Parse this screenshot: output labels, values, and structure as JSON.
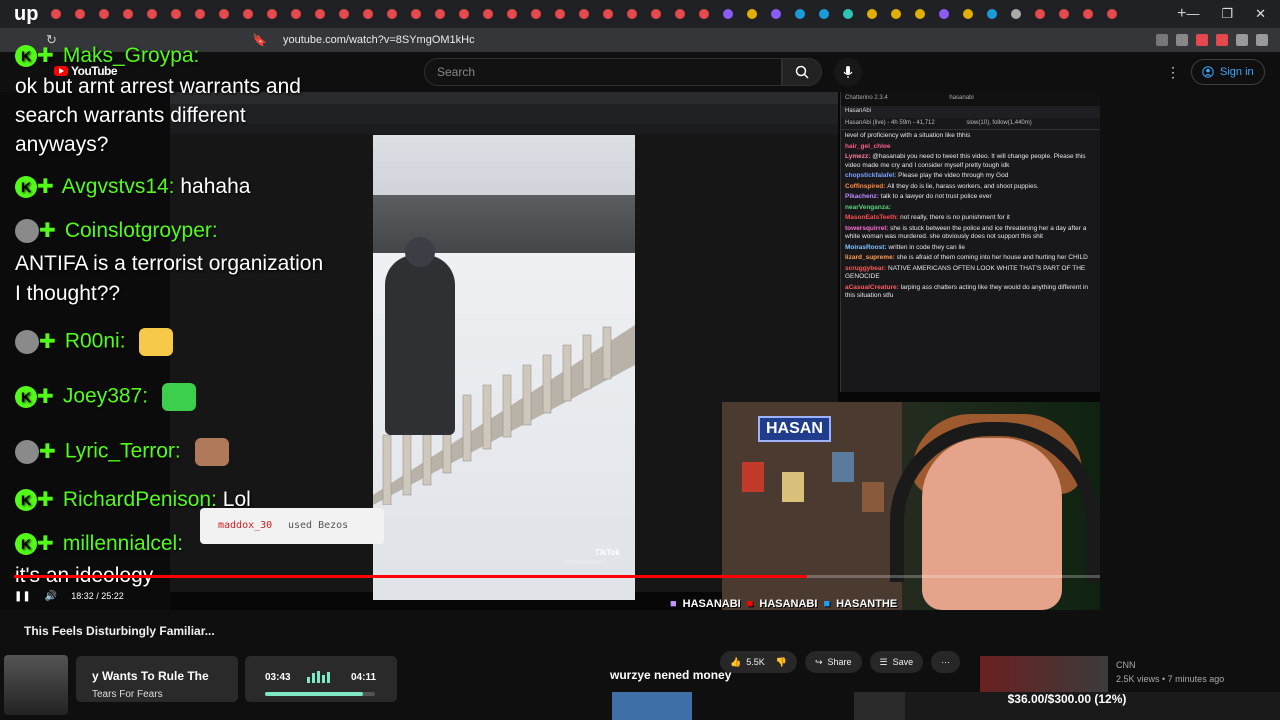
{
  "browser": {
    "brand": "up",
    "url": "youtube.com/watch?v=8SYmgOM1kHc",
    "tab_colors": [
      "#e5484d",
      "#e5484d",
      "#e5484d",
      "#e5484d",
      "#e5484d",
      "#e5484d",
      "#e5484d",
      "#e5484d",
      "#e5484d",
      "#e5484d",
      "#e5484d",
      "#e5484d",
      "#e5484d",
      "#e5484d",
      "#e5484d",
      "#e5484d",
      "#e5484d",
      "#e5484d",
      "#e5484d",
      "#e5484d",
      "#e5484d",
      "#e5484d",
      "#e5484d",
      "#e5484d",
      "#e5484d",
      "#e5484d",
      "#e5484d",
      "#e5484d",
      "#8b5cf6",
      "#e0b000",
      "#8b5cf6",
      "#1a9bd7",
      "#1a9bd7",
      "#2ec4b6",
      "#e0b000",
      "#e0b000",
      "#e0b000",
      "#8b5cf6",
      "#e0b000",
      "#1a9bd7",
      "#aaaaaa",
      "#e5484d",
      "#e5484d",
      "#e5484d",
      "#e5484d"
    ]
  },
  "youtube": {
    "logo": "YouTube",
    "search_placeholder": "Search",
    "sign_in": "Sign in"
  },
  "stream_chat": [
    {
      "user": "Maks_Groypa:",
      "msg": ""
    },
    {
      "user": "",
      "msg": "ok but arnt arrest warrants and"
    },
    {
      "user": "",
      "msg": "search warrants different"
    },
    {
      "user": "",
      "msg": "anyways?"
    },
    {
      "user": "Avgvstvs14:",
      "msg": "hahaha"
    },
    {
      "user": "Coinslotgroyper:",
      "msg": ""
    },
    {
      "user": "",
      "msg": "ANTIFA is a terrorist organization"
    },
    {
      "user": "",
      "msg": "I thought??"
    },
    {
      "user": "R00ni:",
      "msg": ""
    },
    {
      "user": "Joey387:",
      "msg": ""
    },
    {
      "user": "Lyric_Terror:",
      "msg": ""
    },
    {
      "user": "RichardPenison:",
      "msg": "Lol"
    },
    {
      "user": "millennialcel:",
      "msg": ""
    },
    {
      "user": "",
      "msg": "it's an ideology"
    }
  ],
  "redeem": {
    "user": "maddox_30",
    "text": "used Bezos"
  },
  "chatterino": {
    "title": "Chatterino 2.3.4",
    "channel": "hasanabi",
    "tab": "HasanAbi",
    "status": "HasanAbi (live) - 4h 59m - 41,712",
    "mode": "slow(10), follow(1,440m)",
    "messages": [
      {
        "user": "",
        "text": "level of proficiency with a situation like thhis"
      },
      {
        "user": "hair_gel_chloe",
        "text": ""
      },
      {
        "user": "Lymezz:",
        "text": "@hasanabi you need to tweet this video. It will change people. Please this video made me cry and I consider myself pretty tough idk"
      },
      {
        "user": "chopstickfalafel:",
        "text": "Please play the video through my God"
      },
      {
        "user": "Coffinspired:",
        "text": "All they do is lie, harass workers, and shoot puppies."
      },
      {
        "user": "Pikachenz:",
        "text": "talk to a lawyer do not trust police ever"
      },
      {
        "user": "nearVenganza:",
        "text": ""
      },
      {
        "user": "MasonEatsTeeth:",
        "text": "not really, there is no punishment for it"
      },
      {
        "user": "towersquirrel:",
        "text": "she is stuck between the police and ice threatening her a day after a white woman was murdered. she obviously does not support this shit"
      },
      {
        "user": "MoirasRoost:",
        "text": "written in code they can lie"
      },
      {
        "user": "lizard_supreme:",
        "text": "she is afraid of them coming into her house and hurting her CHILD"
      },
      {
        "user": "scruggybear:",
        "text": "NATIVE AMERICANS OFTEN LOOK WHITE THAT'S PART OF THE GENOCIDE"
      },
      {
        "user": "aCasualCreature:",
        "text": "larping ass chatters acting like they would do anything different in this situation stfu"
      }
    ]
  },
  "tiktok": {
    "watermark": "TikTok",
    "user": "@stormbaby27"
  },
  "webcam": {
    "logo": "HASAN"
  },
  "socials": [
    "HASANABI",
    "HASANABI",
    "HASANTHE"
  ],
  "player": {
    "current": "18:32",
    "duration": "25:22",
    "progress_fraction": 0.73
  },
  "video": {
    "title": "This Feels Disturbingly Familiar...",
    "likes": "5.5K",
    "share": "Share",
    "save": "Save"
  },
  "music": {
    "title": "y Wants To Rule The",
    "artist": "Tears For Fears",
    "current": "03:43",
    "total": "04:11",
    "progress_fraction": 0.89
  },
  "tts": "wurzye nened money",
  "donation_goal": {
    "label": "$36.00/$300.00 (12%)",
    "fraction": 0.12
  },
  "recommended": {
    "channel": "CNN",
    "meta": "2.5K views • 7 minutes ago"
  }
}
